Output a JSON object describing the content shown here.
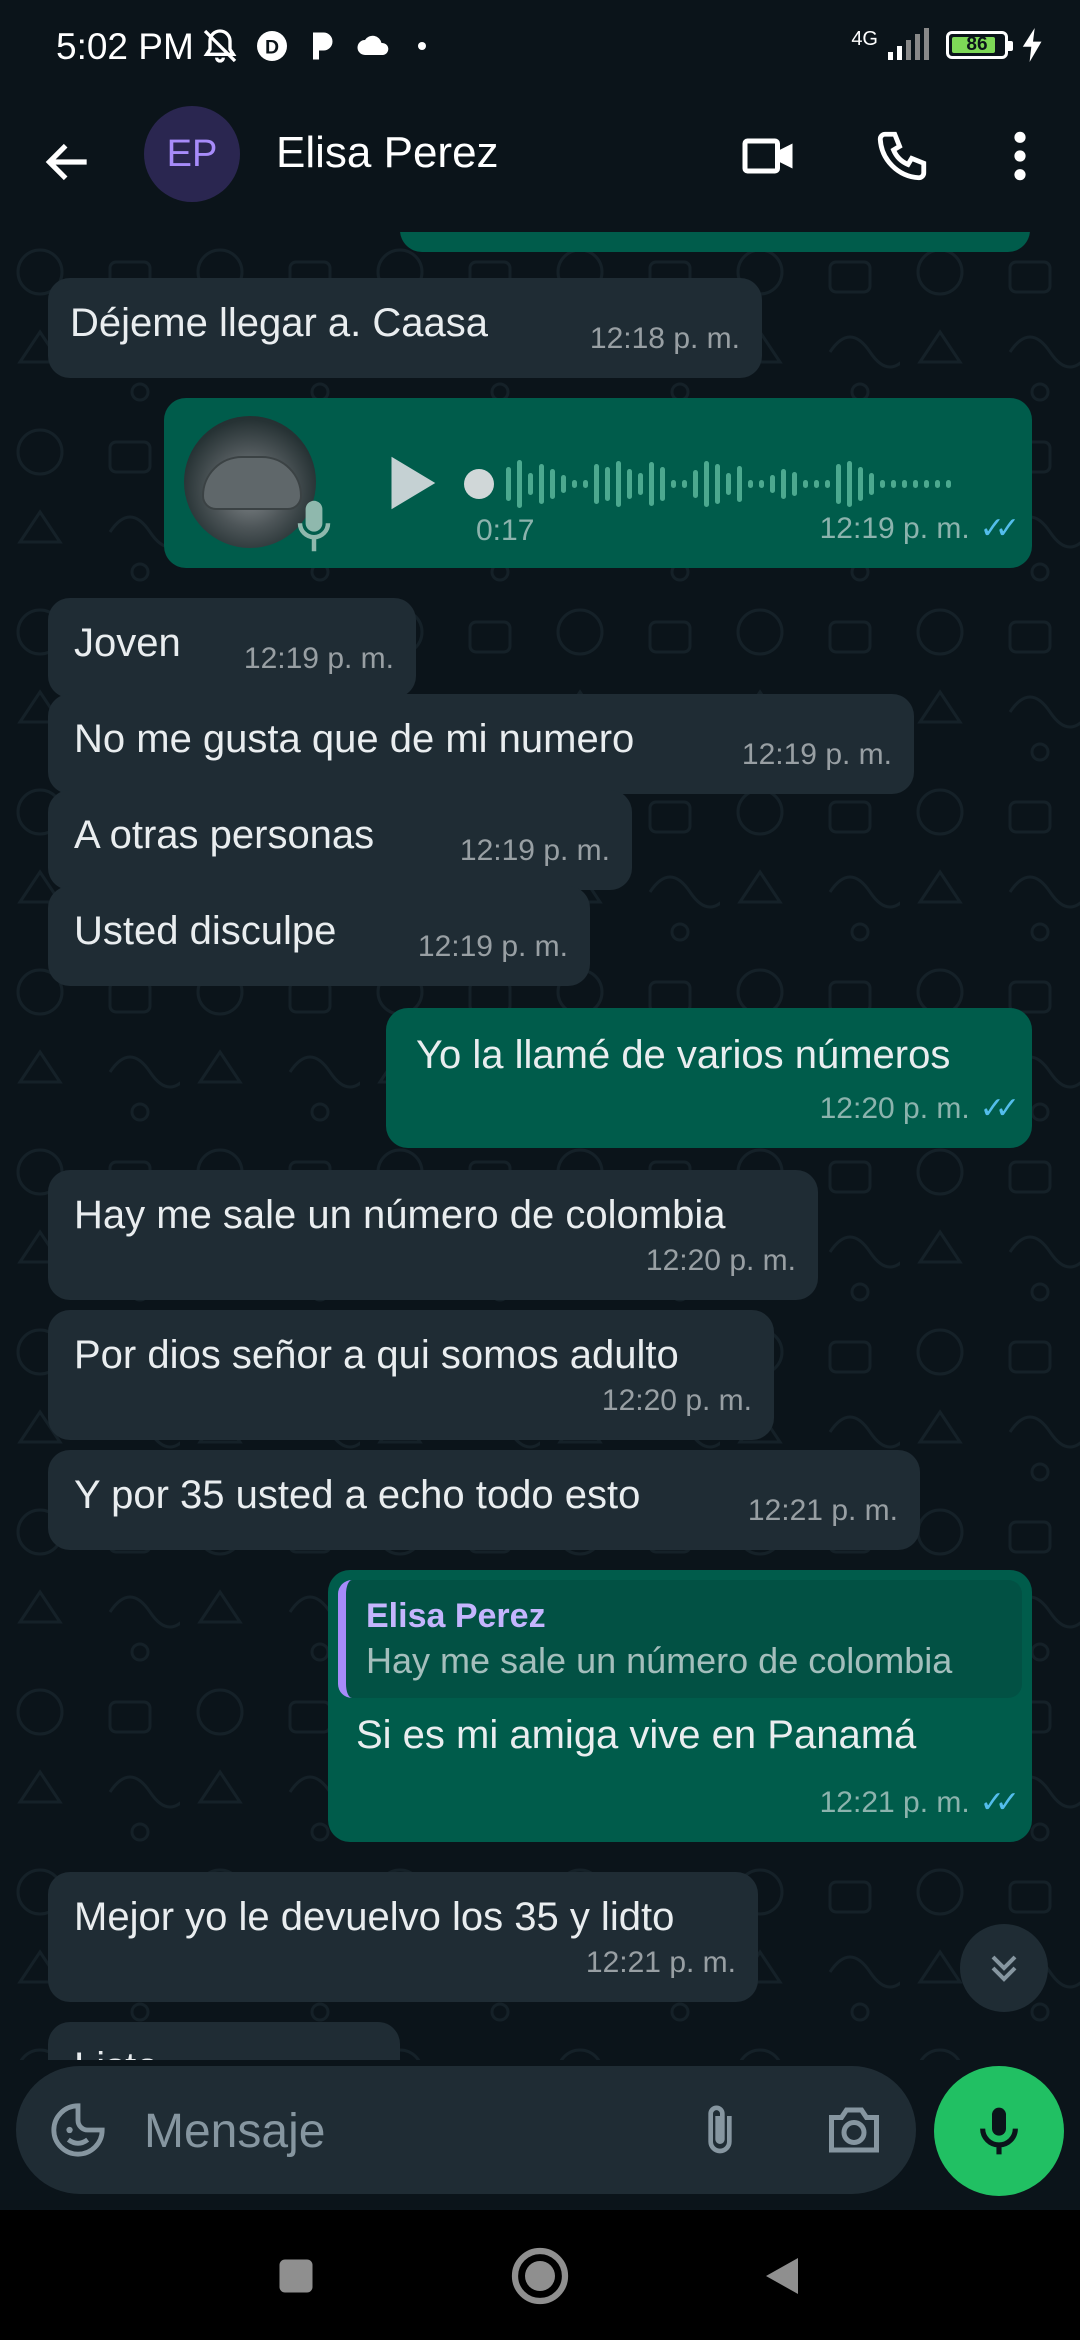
{
  "status_bar": {
    "time": "5:02 PM",
    "network": "4G",
    "battery": 86
  },
  "header": {
    "avatar_initials": "EP",
    "contact_name": "Elisa Perez"
  },
  "messages": [
    {
      "dir": "in",
      "text": "Déjeme llegar a.  Caasa",
      "time": "12:18 p. m."
    },
    {
      "dir": "out",
      "type": "voice",
      "duration": "0:17",
      "time": "12:19 p. m."
    },
    {
      "dir": "in",
      "text": "Joven",
      "time": "12:19 p. m."
    },
    {
      "dir": "in",
      "text": "No me gusta que de mi numero",
      "time": "12:19 p. m."
    },
    {
      "dir": "in",
      "text": "A otras personas",
      "time": "12:19 p. m."
    },
    {
      "dir": "in",
      "text": "Usted disculpe",
      "time": "12:19 p. m."
    },
    {
      "dir": "out",
      "text": "Yo la llamé de varios números",
      "time": "12:20 p. m."
    },
    {
      "dir": "in",
      "text": "Hay me sale un número de colombia",
      "time": "12:20 p. m."
    },
    {
      "dir": "in",
      "text": "Por dios señor a qui somos adulto",
      "time": "12:20 p. m."
    },
    {
      "dir": "in",
      "text": "Y por 35 usted a echo todo esto",
      "time": "12:21 p. m."
    },
    {
      "dir": "out",
      "quote_name": "Elisa Perez",
      "quote_text": "Hay me sale un número de colombia",
      "text": "Si es mi amiga vive en Panamá",
      "time": "12:21 p. m."
    },
    {
      "dir": "in",
      "text": "Mejor yo le devuelvo los 35 y lidto",
      "time": "12:21 p. m."
    },
    {
      "dir": "in",
      "text": "Listo",
      "time": ""
    }
  ],
  "composer": {
    "placeholder": "Mensaje"
  },
  "colors": {
    "background": "#0b141a",
    "incoming_bubble": "#1f2c34",
    "outgoing_bubble": "#005c4b",
    "read_ticks": "#53bdeb",
    "mic_button": "#21c063",
    "avatar_text": "#a78bfa"
  }
}
